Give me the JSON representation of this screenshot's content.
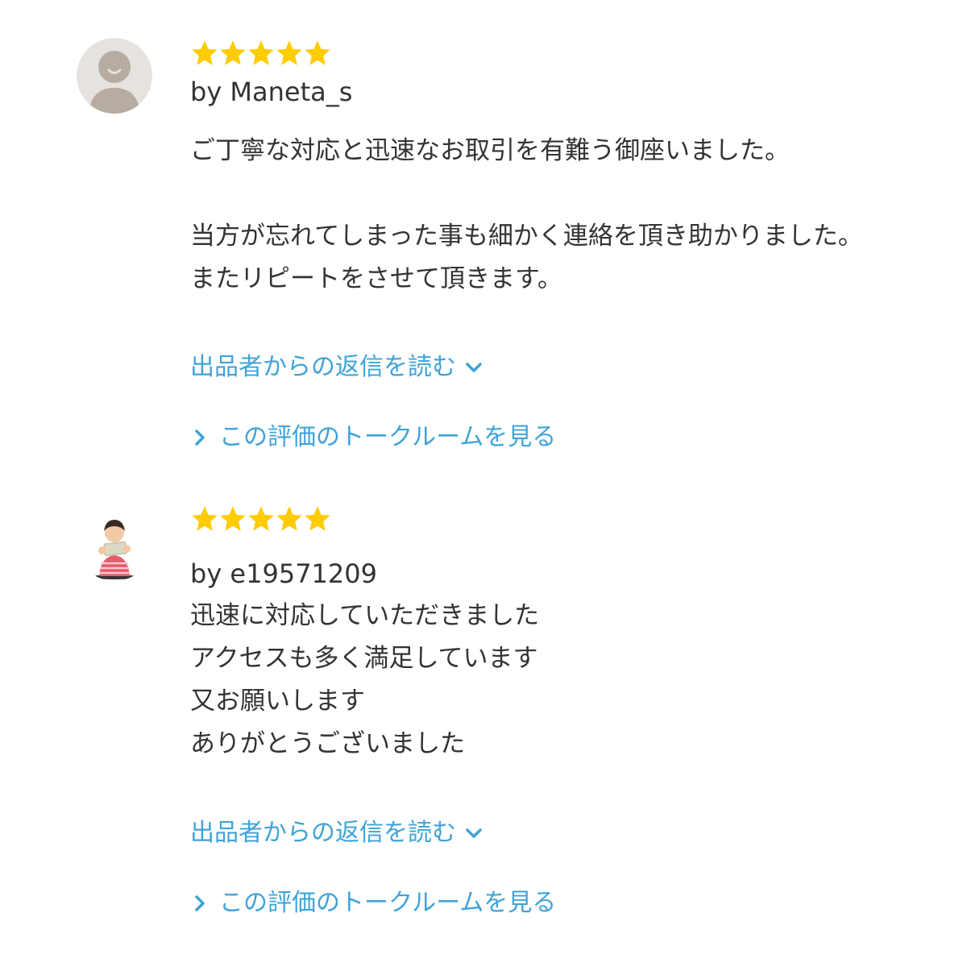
{
  "reviews": [
    {
      "rating": 5,
      "reviewer": "by Maneta_s",
      "comment": "ご丁寧な対応と迅速なお取引を有難う御座いました。\n\n当方が忘れてしまった事も細かく連絡を頂き助かりました。\nまたリピートをさせて頂きます。",
      "avatar_icon": "default-person-icon",
      "reply_link": "出品者からの返信を読む",
      "talk_link": "この評価のトークルームを見る"
    },
    {
      "rating": 5,
      "reviewer": "by e19571209",
      "comment": "迅速に対応していただきました\nアクセスも多く満足しています\n又お願いします\nありがとうございました",
      "avatar_icon": "user-photo",
      "reply_link": "出品者からの返信を読む",
      "talk_link": "この評価のトークルームを見る"
    }
  ],
  "colors": {
    "star": "#ffcc00",
    "link": "#3fa3d8",
    "text": "#333333",
    "avatar_bg": "#e6e2df",
    "avatar_figure": "#b7aca2"
  }
}
